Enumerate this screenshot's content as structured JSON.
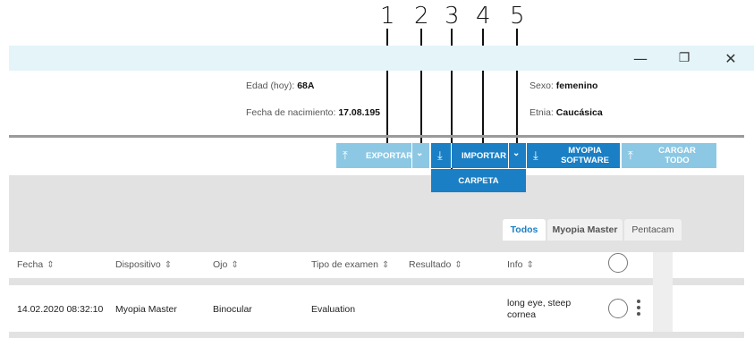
{
  "callouts": [
    "1",
    "2",
    "3",
    "4",
    "5"
  ],
  "window": {
    "minimize_icon": "—",
    "restore_icon": "❐",
    "close_icon": "✕"
  },
  "patient": {
    "age_label": "Edad (hoy): ",
    "age_value": "68A",
    "dob_label": "Fecha de nacimiento: ",
    "dob_value": "17.08.195",
    "sex_label": "Sexo: ",
    "sex_value": "femenino",
    "ethnicity_label": "Etnia: ",
    "ethnicity_value": "Caucásica"
  },
  "toolbar": {
    "export_label": "EXPORTAR",
    "import_label": "IMPORTAR",
    "myopia_software_label": "MYOPIA SOFTWARE",
    "upload_all_label": "CARGAR TODO",
    "dropdown_item": "CARPETA",
    "upload_icon": "⤒",
    "download_icon": "⤓",
    "chevron": "⌄"
  },
  "tabs": [
    "Todos",
    "Myopia Master",
    "Pentacam"
  ],
  "table": {
    "columns": [
      "Fecha",
      "Dispositivo",
      "Ojo",
      "Tipo de examen",
      "Resultado",
      "Info"
    ],
    "sort_icon": "⇕",
    "rows": [
      {
        "fecha": "14.02.2020 08:32:10",
        "dispositivo": "Myopia Master",
        "ojo": "Binocular",
        "tipo": "Evaluation",
        "resultado": "",
        "info_line1": "long eye, steep",
        "info_line2": "cornea"
      }
    ]
  },
  "colors": {
    "primary": "#1a7fc4",
    "disabled": "#8cc8e4",
    "titlebar": "#e4f4f9",
    "panel": "#e2e2e2"
  }
}
